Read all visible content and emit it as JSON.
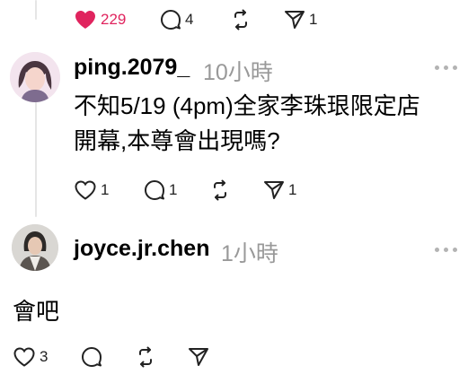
{
  "thread": {
    "top_actions": {
      "likes": "229",
      "comments": "4",
      "reposts": "",
      "shares": "1"
    },
    "comments": [
      {
        "username": "ping.2079_",
        "time": "10小時",
        "text_lines": [
          "不知5/19 (4pm)全家李珠珢限定店",
          "開幕,本尊會出現嗎?"
        ],
        "likes": "1",
        "comments": "1",
        "shares": "1"
      },
      {
        "username": "joyce.jr.chen",
        "time": "1小時",
        "text": "會吧",
        "likes": "3"
      }
    ]
  },
  "colors": {
    "like_active": "#e0245e",
    "muted": "#999999",
    "thread_line": "#e6e6e6"
  },
  "icons": [
    "heart-filled-icon",
    "comment-icon",
    "repost-icon",
    "share-icon",
    "heart-icon",
    "more-icon"
  ]
}
